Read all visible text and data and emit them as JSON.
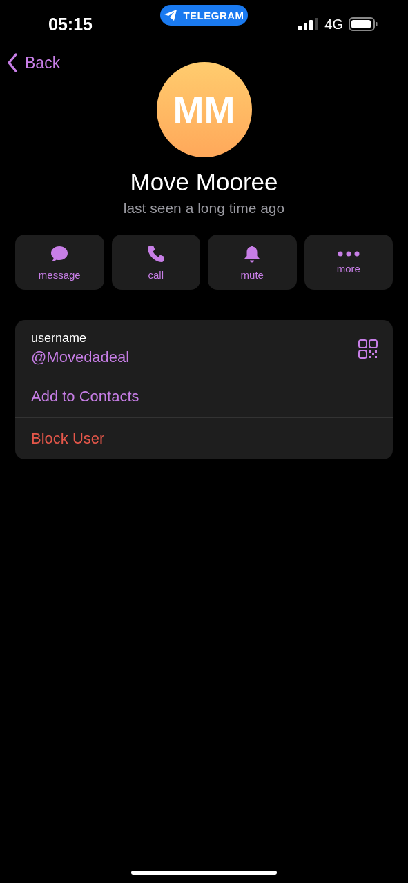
{
  "status_bar": {
    "time": "05:15",
    "app_pill": "TELEGRAM",
    "network": "4G"
  },
  "nav": {
    "back": "Back"
  },
  "profile": {
    "initials": "MM",
    "name": "Move Mooree",
    "status": "last seen a long time ago"
  },
  "actions": [
    {
      "kind": "message",
      "label": "message"
    },
    {
      "kind": "call",
      "label": "call"
    },
    {
      "kind": "mute",
      "label": "mute"
    },
    {
      "kind": "more",
      "label": "more"
    }
  ],
  "info": {
    "username_label": "username",
    "username": "@Movedadeal"
  },
  "menu": [
    {
      "kind": "action",
      "label": "Add to Contacts"
    },
    {
      "kind": "destructive",
      "label": "Block User"
    }
  ]
}
